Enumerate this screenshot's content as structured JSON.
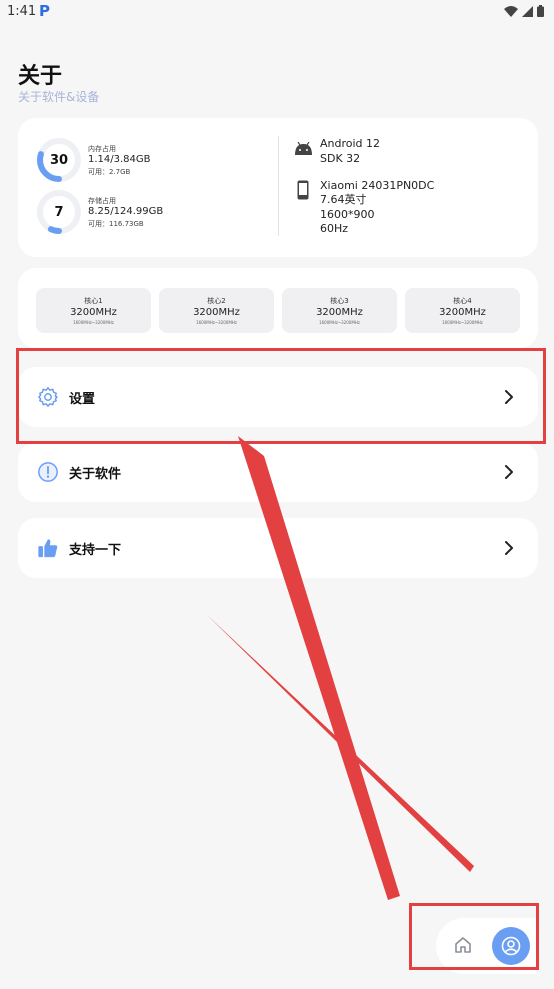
{
  "status_bar": {
    "time": "1:41",
    "app_badge": "P",
    "icons": [
      "wifi-icon",
      "signal-icon",
      "battery-icon"
    ]
  },
  "page": {
    "title": "关于",
    "subtitle": "关于软件&设备"
  },
  "memory": {
    "percent": "30",
    "percent_value": 30,
    "label": "内存占用",
    "value": "1.14/3.84GB",
    "available": "可用：2.7GB"
  },
  "storage": {
    "percent": "7",
    "percent_value": 7,
    "label": "存储占用",
    "value": "8.25/124.99GB",
    "available": "可用：116.73GB"
  },
  "device": {
    "android": "Android 12",
    "sdk": "SDK 32",
    "model": "Xiaomi 24031PN0DC",
    "screen_size": "7.64英寸",
    "resolution": "1600*900",
    "refresh_rate": "60Hz"
  },
  "cpu": {
    "cores": [
      {
        "name": "核心1",
        "freq": "3200MHz",
        "range": "1600MHz~3200MHz"
      },
      {
        "name": "核心2",
        "freq": "3200MHz",
        "range": "1600MHz~3200MHz"
      },
      {
        "name": "核心3",
        "freq": "3200MHz",
        "range": "1600MHz~3200MHz"
      },
      {
        "name": "核心4",
        "freq": "3200MHz",
        "range": "1600MHz~3200MHz"
      }
    ]
  },
  "menu": {
    "settings": "设置",
    "about": "关于软件",
    "support": "支持一下"
  },
  "bottom_nav": {
    "items": [
      "home-icon",
      "profile-icon"
    ],
    "active": "profile-icon"
  },
  "colors": {
    "accent": "#6a9ef2",
    "highlight": "#e34141",
    "subtitle": "#a7b5d6"
  }
}
